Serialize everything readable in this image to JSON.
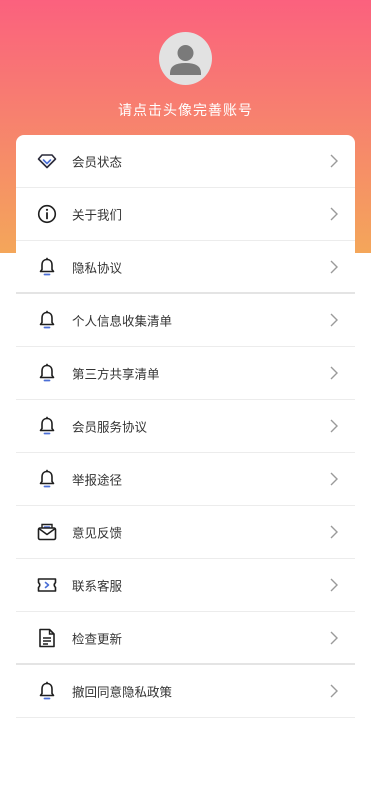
{
  "header": {
    "title": "请点击头像完善账号",
    "gradient_top": "#fb617e",
    "gradient_bottom": "#f4a65a"
  },
  "menu": {
    "items": [
      {
        "label": "会员状态",
        "icon": "diamond-icon"
      },
      {
        "label": "关于我们",
        "icon": "info-icon"
      },
      {
        "label": "隐私协议",
        "icon": "bell-icon"
      },
      {
        "label": "个人信息收集清单",
        "icon": "bell-icon"
      },
      {
        "label": "第三方共享清单",
        "icon": "bell-icon"
      },
      {
        "label": "会员服务协议",
        "icon": "bell-icon"
      },
      {
        "label": "举报途径",
        "icon": "bell-icon"
      },
      {
        "label": "意见反馈",
        "icon": "envelope-icon"
      },
      {
        "label": "联系客服",
        "icon": "ticket-icon"
      },
      {
        "label": "检查更新",
        "icon": "document-icon"
      },
      {
        "label": "撤回同意隐私政策",
        "icon": "bell-icon"
      }
    ]
  }
}
